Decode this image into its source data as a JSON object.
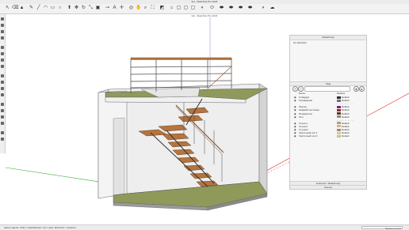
{
  "window": {
    "title": "Ilet - SketchUp Pro 2023"
  },
  "document": {
    "label": "lab - SketchUp Pro 2023"
  },
  "toolbar": {
    "icons": [
      "select-icon",
      "eraser-icon",
      "paint-icon",
      "pencil-icon",
      "line-icon",
      "arc-icon",
      "rectangle-icon",
      "circle-icon",
      "push-pull-icon",
      "move-icon",
      "rotate-icon",
      "scale-icon",
      "offset-icon",
      "tape-icon",
      "text-icon",
      "axes-icon",
      "orbit-icon",
      "pan-icon",
      "zoom-icon",
      "zoom-extents-icon",
      "section-icon",
      "standard-view-icon",
      "styles-icon",
      "shadows-icon"
    ]
  },
  "tray": {
    "header": "Default tray",
    "entity_info": "No Selection",
    "tags_header": "Tags",
    "columns": {
      "name": "Name",
      "style": "Dashes"
    },
    "tags": [
      {
        "name": "Untagged",
        "color": "#2b2b2b",
        "style": "Default"
      },
      {
        "name": "Ограждение",
        "color": "#6e6e6e",
        "style": "Default"
      },
      {
        "name": "",
        "color": "",
        "style": ""
      },
      {
        "name": "Паутер",
        "color": "#6b2d7a",
        "style": "Default"
      },
      {
        "name": "Нарёкий лестница",
        "color": "#9a2a3a",
        "style": "Default"
      },
      {
        "name": "Перекрытие",
        "color": "#5a3a1a",
        "style": "Default"
      },
      {
        "name": "Пол",
        "color": "#8a8a8a",
        "style": "Default"
      },
      {
        "name": "",
        "color": "",
        "style": ""
      },
      {
        "name": "Стена 1",
        "color": "#b9a06a",
        "style": "Default"
      },
      {
        "name": "Стена 2",
        "color": "#c9b79a",
        "style": "Default"
      },
      {
        "name": "Ступени",
        "color": "#a08c70",
        "style": "Default"
      },
      {
        "name": "Частичный пол 1",
        "color": "#d4c89a",
        "style": "Default"
      },
      {
        "name": "Частичный пол 2",
        "color": "#cfc08a",
        "style": "Default"
      }
    ],
    "footer_1": "Instructor / Default tray",
    "footer_2": "Scenes"
  },
  "status": {
    "text": "Select objects. Shift = Add/Subtract. Ctrl = Add. Shift+Ctrl = Subtract.",
    "measurements_label": "Measurements"
  }
}
